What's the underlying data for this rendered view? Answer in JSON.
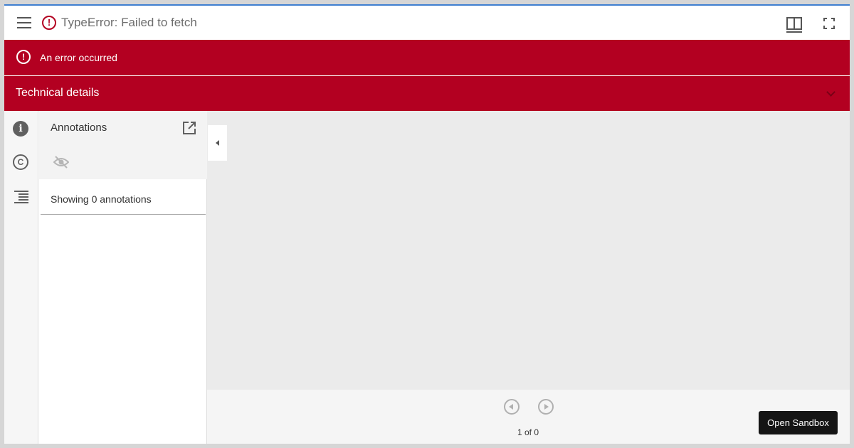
{
  "header": {
    "title": "TypeError: Failed to fetch",
    "menu_icon": "hamburger-menu-icon",
    "error_icon": "error-circle-icon",
    "layout_icon": "two-column-layout-icon",
    "fullscreen_icon": "fullscreen-icon"
  },
  "error": {
    "message": "An error occurred",
    "icon_glyph": "!",
    "details_label": "Technical details",
    "color": "#b30021"
  },
  "rail": {
    "items": [
      {
        "name": "info",
        "icon": "info-icon",
        "glyph": "i"
      },
      {
        "name": "rights",
        "icon": "copyright-icon",
        "glyph": "C"
      },
      {
        "name": "contents",
        "icon": "table-of-contents-icon"
      }
    ]
  },
  "annotations": {
    "title": "Annotations",
    "count_text": "Showing 0 annotations",
    "popout_icon": "open-in-new-icon",
    "visibility_icon": "visibility-off-icon"
  },
  "footer": {
    "page_text": "1 of 0",
    "sandbox_label": "Open Sandbox"
  },
  "colors": {
    "accent_bar": "#3f7fd0",
    "error_red": "#b30021",
    "sandbox_button": "#151515"
  }
}
